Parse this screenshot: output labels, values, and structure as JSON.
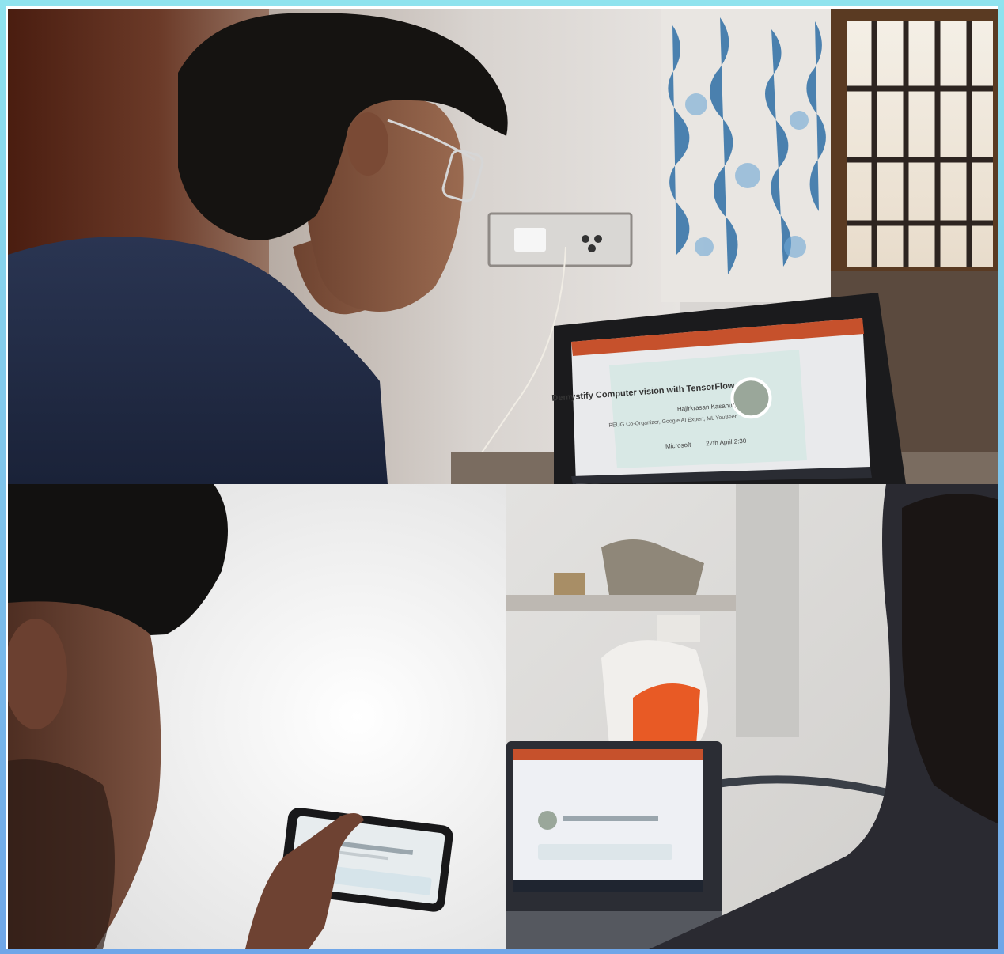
{
  "photos": [
    {
      "id": "top",
      "screen": {
        "title": "Demystify Computer vision with TensorFlow",
        "presenter": "Hajirkrasan Kasanur,",
        "affiliation": "PEUG Co-Organizer, Google AI Expert, ML YouBeer",
        "footer_left": "27th April 2:30",
        "footer_right": "Microsoft"
      }
    },
    {
      "id": "bottom-left"
    },
    {
      "id": "bottom-right"
    }
  ],
  "colors": {
    "frame_top": "#8fe3ee",
    "frame_bottom": "#6fa6e8",
    "shirt": "#1f2a44",
    "ribbon": "#c5502a",
    "curtain_blue": "#2f6fa6"
  }
}
